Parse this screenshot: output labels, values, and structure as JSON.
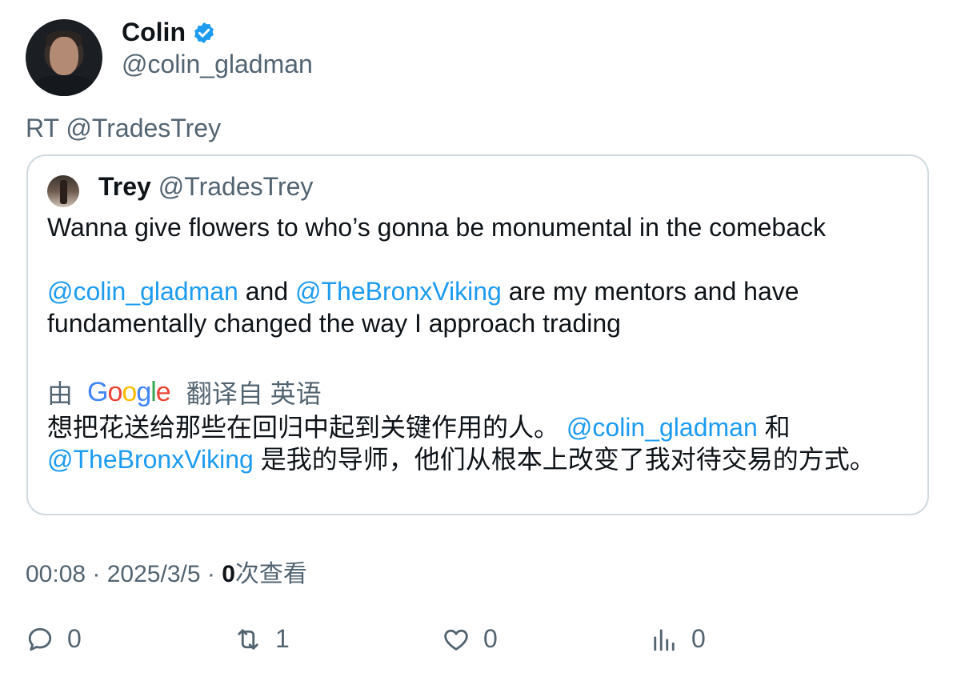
{
  "author": {
    "name": "Colin",
    "handle": "@colin_gladman",
    "verified": true
  },
  "retweet_label": "RT @TradesTrey",
  "quoted_tweet": {
    "name": "Trey",
    "handle": "@TradesTrey",
    "line1": "Wanna give flowers to who’s gonna be monumental in the comeback",
    "mention1": "@colin_gladman",
    "and_text": " and ",
    "mention2": "@TheBronxViking",
    "line2_rest": " are my mentors and have fundamentally changed the way I approach trading",
    "translation": {
      "by_label": "由",
      "google_logo_text": "Google",
      "translated_from": "翻译自 英语",
      "zh_part1": "想把花送给那些在回归中起到关键作用的人。 ",
      "zh_mention1": "@colin_gladman",
      "zh_and": " 和",
      "zh_mention2": "@TheBronxViking",
      "zh_part2": " 是我的导师，他们从根本上改变了我对待交易的方式。"
    }
  },
  "meta": {
    "time": "00:08",
    "separator": " · ",
    "date": "2025/3/5",
    "views_count": "0",
    "views_label": "次查看"
  },
  "actions": {
    "reply_count": "0",
    "retweet_count": "1",
    "like_count": "0",
    "views_count": "0"
  },
  "colors": {
    "accent": "#1d9bf0",
    "secondary_text": "#536471",
    "border": "#cfd9de"
  }
}
